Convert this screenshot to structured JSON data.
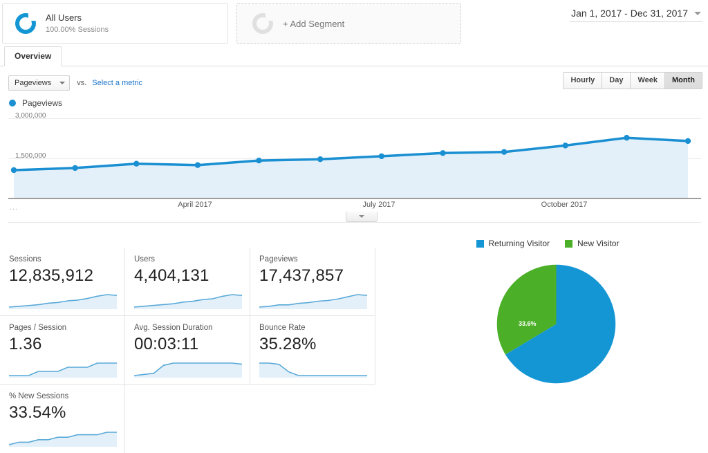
{
  "segments": {
    "all_users": {
      "title": "All Users",
      "subtitle": "100.00% Sessions",
      "icon": "donut-icon"
    },
    "add_segment": {
      "label": "+ Add Segment",
      "icon": "donut-outline-icon"
    }
  },
  "date_range": {
    "label": "Jan 1, 2017 - Dec 31, 2017",
    "icon": "chevron-down-icon"
  },
  "tabs": [
    {
      "label": "Overview",
      "active": true
    }
  ],
  "metric_selector": {
    "selected": "Pageviews",
    "vs_label": "vs.",
    "compare_link": "Select a metric",
    "caret": "chevron-down-icon"
  },
  "granularity": {
    "options": [
      "Hourly",
      "Day",
      "Week",
      "Month"
    ],
    "selected": "Month"
  },
  "chart_legend": {
    "label": "Pageviews",
    "color": "#1a8fd1"
  },
  "slider": {
    "icon": "chevron-down-icon"
  },
  "x_axis_prefix": "...",
  "chart_data": {
    "type": "line",
    "title": "Pageviews",
    "xlabel": "",
    "ylabel": "Pageviews",
    "ylim": [
      0,
      3000000
    ],
    "yticks": [
      1500000,
      3000000
    ],
    "ytick_labels": [
      "1,500,000",
      "3,000,000"
    ],
    "grid": true,
    "legend_position": "top-left",
    "fill": true,
    "line_color": "#1a8fd1",
    "fill_color": "#e3f0f9",
    "categories": [
      "January 2017",
      "February 2017",
      "March 2017",
      "April 2017",
      "May 2017",
      "June 2017",
      "July 2017",
      "August 2017",
      "September 2017",
      "October 2017",
      "November 2017",
      "December 2017"
    ],
    "xtick_labels": [
      "April 2017",
      "July 2017",
      "October 2017"
    ],
    "values": [
      1060000,
      1140000,
      1300000,
      1250000,
      1420000,
      1470000,
      1580000,
      1700000,
      1740000,
      1980000,
      2270000,
      2150000
    ]
  },
  "metric_cards": [
    {
      "label": "Sessions",
      "value": "12,835,912",
      "spark": [
        8,
        9,
        10,
        11,
        13,
        14,
        16,
        17,
        19,
        22,
        24,
        23
      ]
    },
    {
      "label": "Users",
      "value": "4,404,131",
      "spark": [
        8,
        9,
        10,
        11,
        12,
        14,
        15,
        17,
        18,
        21,
        23,
        22
      ]
    },
    {
      "label": "Pageviews",
      "value": "17,437,857",
      "spark": [
        7,
        8,
        10,
        10,
        12,
        13,
        15,
        16,
        18,
        21,
        24,
        23
      ]
    },
    {
      "label": "Pages / Session",
      "value": "1.36",
      "spark": [
        14,
        14,
        14,
        15,
        15,
        15,
        16,
        16,
        16,
        17,
        17,
        17
      ]
    },
    {
      "label": "Avg. Session Duration",
      "value": "00:03:11",
      "spark": [
        7,
        8,
        9,
        16,
        18,
        18,
        18,
        18,
        18,
        18,
        18,
        17
      ]
    },
    {
      "label": "Bounce Rate",
      "value": "35.28%",
      "spark": [
        21,
        21,
        20,
        14,
        11,
        11,
        11,
        11,
        11,
        11,
        11,
        11
      ]
    },
    {
      "label": "% New Sessions",
      "value": "33.54%",
      "spark": [
        14,
        15,
        15,
        16,
        16,
        17,
        17,
        18,
        18,
        18,
        19,
        19
      ]
    }
  ],
  "pie_chart": {
    "chart_data": {
      "type": "pie",
      "title": "",
      "labels": [
        "Returning Visitor",
        "New Visitor"
      ],
      "values": [
        66.4,
        33.6
      ],
      "value_labels": [
        "66.4%",
        "33.6%"
      ],
      "colors": [
        "#1496d4",
        "#4caf28"
      ],
      "legend_position": "top"
    }
  }
}
